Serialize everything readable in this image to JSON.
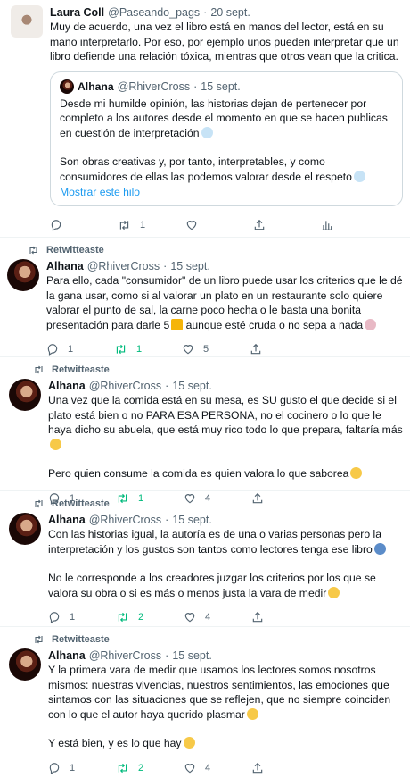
{
  "retweet_label": "Retwitteaste",
  "tweets": [
    {
      "name": "Laura Coll",
      "handle": "@Paseando_pags",
      "sep": "·",
      "date": "20 sept.",
      "text": [
        "Muy de acuerdo, una vez el libro está en manos del lector, está en su mano interpretarlo. Por eso, por ejemplo unos pueden interpretar que un libro defiende una relación tóxica, mientras que otros vean que la critica."
      ],
      "quote": {
        "name": "Alhana",
        "handle": "@RhiverCross",
        "sep": "·",
        "date": "15 sept.",
        "p1": "Desde mi humilde opinión, las historias dejan de pertenecer por completo a los autores desde el momento en que se hacen publicas en cuestión de interpretación",
        "p2": "Son obras creativas y, por tanto, interpretables, y como consumidores de ellas las podemos valorar desde el respeto",
        "show_thread": "Mostrar este hilo"
      },
      "replies": "",
      "retweets": "1",
      "likes": ""
    },
    {
      "name": "Alhana",
      "handle": "@RhiverCross",
      "sep": "·",
      "date": "15 sept.",
      "p1": "Para ello, cada \"consumidor\" de un libro puede usar los criterios que le dé la gana usar, como si al valorar un plato en un restaurante solo quiere valorar el punto de sal, la carne poco hecha o le basta una bonita presentación para darle 5",
      "p1b": " aunque esté cruda o no sepa a nada",
      "replies": "1",
      "retweets": "1",
      "likes": "5"
    },
    {
      "name": "Alhana",
      "handle": "@RhiverCross",
      "sep": "·",
      "date": "15 sept.",
      "p1": "Una vez que la comida está en su mesa, es SU gusto el que decide si el plato está bien o no PARA ESA PERSONA, no el cocinero o lo que le haya dicho su abuela, que está muy rico todo lo que prepara, faltaría más",
      "p2": "Pero quien consume la comida es quien valora lo que saborea",
      "replies": "1",
      "retweets": "1",
      "likes": "4"
    },
    {
      "name": "Alhana",
      "handle": "@RhiverCross",
      "sep": "·",
      "date": "15 sept.",
      "p1": "Con las historias igual, la autoría es de una o varias personas pero la interpretación y los gustos son tantos como lectores tenga ese libro",
      "p2": "No le corresponde a los creadores juzgar los criterios por los que se valora su obra o si es más o menos justa la vara de medir",
      "replies": "1",
      "retweets": "2",
      "likes": "4"
    },
    {
      "name": "Alhana",
      "handle": "@RhiverCross",
      "sep": "·",
      "date": "15 sept.",
      "p1": "Y la primera vara de medir que usamos los lectores somos nosotros mismos: nuestras vivencias, nuestros sentimientos, las emociones que sintamos con las situaciones que se reflejen, que no siempre coinciden con lo que el autor haya querido plasmar",
      "p2": "Y está bien, y es lo que hay",
      "replies": "1",
      "retweets": "2",
      "likes": "4"
    }
  ],
  "icons": {
    "reply": "reply-icon",
    "retweet": "retweet-icon",
    "like": "heart-icon",
    "share": "share-icon",
    "analytics": "analytics-icon"
  },
  "colors": {
    "text": "#0f1419",
    "muted": "#536471",
    "retweet_active": "#00ba7c",
    "link": "#1d9bf0",
    "border": "#eff3f4"
  }
}
